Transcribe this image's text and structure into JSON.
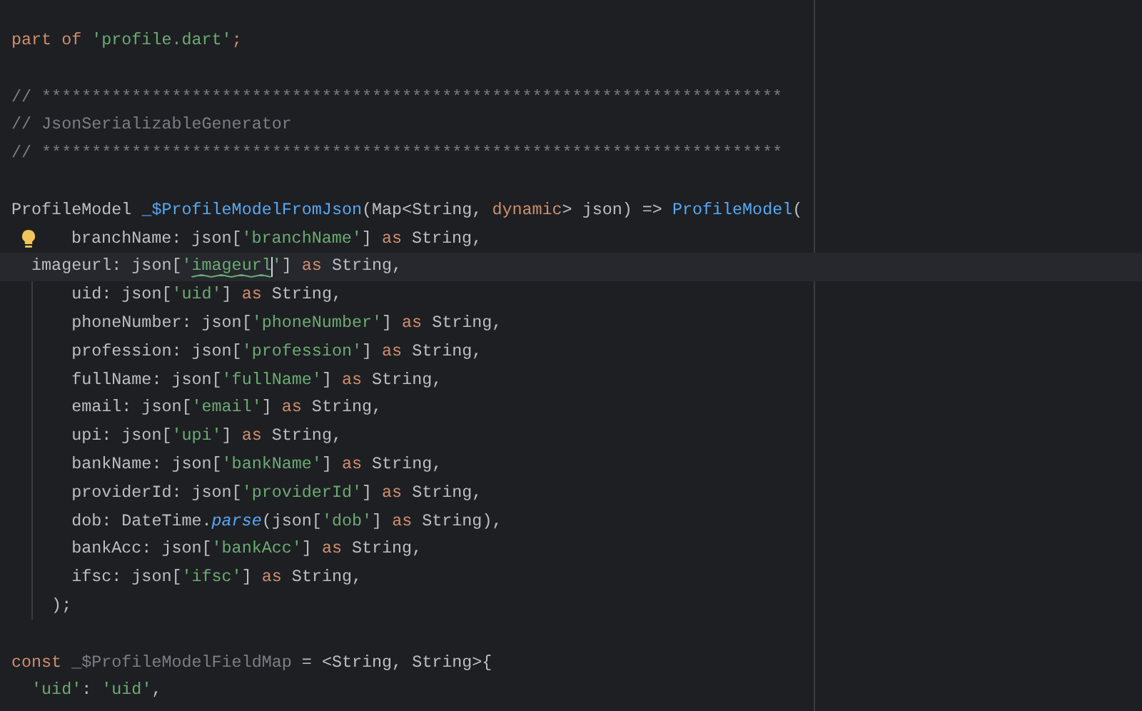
{
  "editor": {
    "lines": [
      {
        "tokens": [
          {
            "text": "part of ",
            "kind": "keyword"
          },
          {
            "text": "'profile.dart'",
            "kind": "string"
          },
          {
            "text": ";",
            "kind": "keyword"
          }
        ]
      },
      {
        "blank_before": true,
        "tokens": [
          {
            "text": "// **************************************************************************",
            "kind": "comment"
          }
        ]
      },
      {
        "tokens": [
          {
            "text": "// JsonSerializableGenerator",
            "kind": "comment"
          }
        ]
      },
      {
        "tokens": [
          {
            "text": "// **************************************************************************",
            "kind": "comment"
          }
        ]
      },
      {
        "blank_before": true,
        "tokens": [
          {
            "text": "ProfileModel ",
            "kind": "plain"
          },
          {
            "text": "_$ProfileModelFromJson",
            "kind": "function"
          },
          {
            "text": "(Map<String, ",
            "kind": "plain"
          },
          {
            "text": "dynamic",
            "kind": "keyword"
          },
          {
            "text": "> json) => ",
            "kind": "plain"
          },
          {
            "text": "ProfileModel",
            "kind": "function"
          },
          {
            "text": "(",
            "kind": "plain"
          }
        ]
      },
      {
        "bulb": true,
        "tokens": [
          {
            "text": "branchName: json[",
            "kind": "plain"
          },
          {
            "text": "'branchName'",
            "kind": "string"
          },
          {
            "text": "] ",
            "kind": "plain"
          },
          {
            "text": "as",
            "kind": "keyword"
          },
          {
            "text": " String,",
            "kind": "plain"
          }
        ]
      },
      {
        "current": true,
        "tokens": [
          {
            "text": "  imageurl: json[",
            "kind": "plain"
          },
          {
            "text": "'",
            "kind": "string"
          },
          {
            "text": "imageurl",
            "kind": "string",
            "warning": true,
            "caret_after": true
          },
          {
            "text": "'",
            "kind": "string"
          },
          {
            "text": "] ",
            "kind": "plain"
          },
          {
            "text": "as",
            "kind": "keyword"
          },
          {
            "text": " String,",
            "kind": "plain"
          }
        ]
      },
      {
        "tokens": [
          {
            "text": "      uid: json[",
            "kind": "plain"
          },
          {
            "text": "'uid'",
            "kind": "string"
          },
          {
            "text": "] ",
            "kind": "plain"
          },
          {
            "text": "as",
            "kind": "keyword"
          },
          {
            "text": " String,",
            "kind": "plain"
          }
        ]
      },
      {
        "tokens": [
          {
            "text": "      phoneNumber: json[",
            "kind": "plain"
          },
          {
            "text": "'phoneNumber'",
            "kind": "string"
          },
          {
            "text": "] ",
            "kind": "plain"
          },
          {
            "text": "as",
            "kind": "keyword"
          },
          {
            "text": " String,",
            "kind": "plain"
          }
        ]
      },
      {
        "tokens": [
          {
            "text": "      profession: json[",
            "kind": "plain"
          },
          {
            "text": "'profession'",
            "kind": "string"
          },
          {
            "text": "] ",
            "kind": "plain"
          },
          {
            "text": "as",
            "kind": "keyword"
          },
          {
            "text": " String,",
            "kind": "plain"
          }
        ]
      },
      {
        "tokens": [
          {
            "text": "      fullName: json[",
            "kind": "plain"
          },
          {
            "text": "'fullName'",
            "kind": "string"
          },
          {
            "text": "] ",
            "kind": "plain"
          },
          {
            "text": "as",
            "kind": "keyword"
          },
          {
            "text": " String,",
            "kind": "plain"
          }
        ]
      },
      {
        "tokens": [
          {
            "text": "      email: json[",
            "kind": "plain"
          },
          {
            "text": "'email'",
            "kind": "string"
          },
          {
            "text": "] ",
            "kind": "plain"
          },
          {
            "text": "as",
            "kind": "keyword"
          },
          {
            "text": " String,",
            "kind": "plain"
          }
        ]
      },
      {
        "tokens": [
          {
            "text": "      upi: json[",
            "kind": "plain"
          },
          {
            "text": "'upi'",
            "kind": "string"
          },
          {
            "text": "] ",
            "kind": "plain"
          },
          {
            "text": "as",
            "kind": "keyword"
          },
          {
            "text": " String,",
            "kind": "plain"
          }
        ]
      },
      {
        "tokens": [
          {
            "text": "      bankName: json[",
            "kind": "plain"
          },
          {
            "text": "'bankName'",
            "kind": "string"
          },
          {
            "text": "] ",
            "kind": "plain"
          },
          {
            "text": "as",
            "kind": "keyword"
          },
          {
            "text": " String,",
            "kind": "plain"
          }
        ]
      },
      {
        "tokens": [
          {
            "text": "      providerId: json[",
            "kind": "plain"
          },
          {
            "text": "'providerId'",
            "kind": "string"
          },
          {
            "text": "] ",
            "kind": "plain"
          },
          {
            "text": "as",
            "kind": "keyword"
          },
          {
            "text": " String,",
            "kind": "plain"
          }
        ]
      },
      {
        "tokens": [
          {
            "text": "      dob: DateTime.",
            "kind": "plain"
          },
          {
            "text": "parse",
            "kind": "static"
          },
          {
            "text": "(json[",
            "kind": "plain"
          },
          {
            "text": "'dob'",
            "kind": "string"
          },
          {
            "text": "] ",
            "kind": "plain"
          },
          {
            "text": "as",
            "kind": "keyword"
          },
          {
            "text": " String),",
            "kind": "plain"
          }
        ]
      },
      {
        "tokens": [
          {
            "text": "      bankAcc: json[",
            "kind": "plain"
          },
          {
            "text": "'bankAcc'",
            "kind": "string"
          },
          {
            "text": "] ",
            "kind": "plain"
          },
          {
            "text": "as",
            "kind": "keyword"
          },
          {
            "text": " String,",
            "kind": "plain"
          }
        ]
      },
      {
        "tokens": [
          {
            "text": "      ifsc: json[",
            "kind": "plain"
          },
          {
            "text": "'ifsc'",
            "kind": "string"
          },
          {
            "text": "] ",
            "kind": "plain"
          },
          {
            "text": "as",
            "kind": "keyword"
          },
          {
            "text": " String,",
            "kind": "plain"
          }
        ]
      },
      {
        "tokens": [
          {
            "text": "    );",
            "kind": "plain"
          }
        ]
      },
      {
        "blank_before": true,
        "tokens": [
          {
            "text": "const ",
            "kind": "keyword"
          },
          {
            "text": "_$ProfileModelFieldMap",
            "kind": "unused"
          },
          {
            "text": " = <String, String>{",
            "kind": "plain"
          }
        ]
      },
      {
        "tokens": [
          {
            "text": "  'uid'",
            "kind": "string"
          },
          {
            "text": ": ",
            "kind": "plain"
          },
          {
            "text": "'uid'",
            "kind": "string"
          },
          {
            "text": ",",
            "kind": "plain"
          }
        ]
      }
    ]
  }
}
